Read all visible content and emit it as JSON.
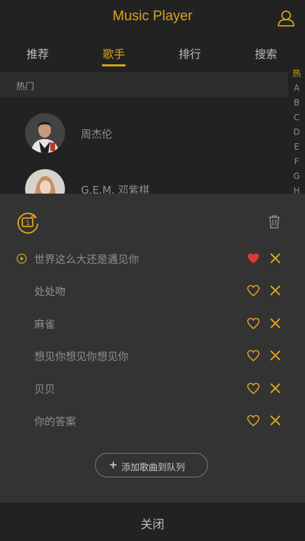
{
  "header": {
    "title": "Music Player",
    "user_icon": "user-icon"
  },
  "tabs": [
    {
      "label": "推荐",
      "active": false
    },
    {
      "label": "歌手",
      "active": true
    },
    {
      "label": "排行",
      "active": false
    },
    {
      "label": "搜索",
      "active": false
    }
  ],
  "singers": {
    "section_label": "热门",
    "items": [
      {
        "name": "周杰伦"
      },
      {
        "name": "G.E.M. 邓紫棋"
      }
    ]
  },
  "alphabet_index": [
    "热",
    "A",
    "B",
    "C",
    "D",
    "E",
    "F",
    "G",
    "H"
  ],
  "playlist": {
    "mode_icon": "repeat-one-icon",
    "clear_icon": "trash-icon",
    "songs": [
      {
        "name": "世界这么大还是遇见你",
        "playing": true,
        "favorite": true
      },
      {
        "name": "处处吻",
        "playing": false,
        "favorite": false
      },
      {
        "name": "麻雀",
        "playing": false,
        "favorite": false
      },
      {
        "name": "想见你想见你想见你",
        "playing": false,
        "favorite": false
      },
      {
        "name": "贝贝",
        "playing": false,
        "favorite": false
      },
      {
        "name": "你的答案",
        "playing": false,
        "favorite": false
      }
    ],
    "add_label": "添加歌曲到队列"
  },
  "close_label": "关闭",
  "colors": {
    "accent": "#d9a520",
    "favorite_active": "#d93a3a",
    "sheet_bg": "#333333",
    "page_bg": "#222222"
  }
}
